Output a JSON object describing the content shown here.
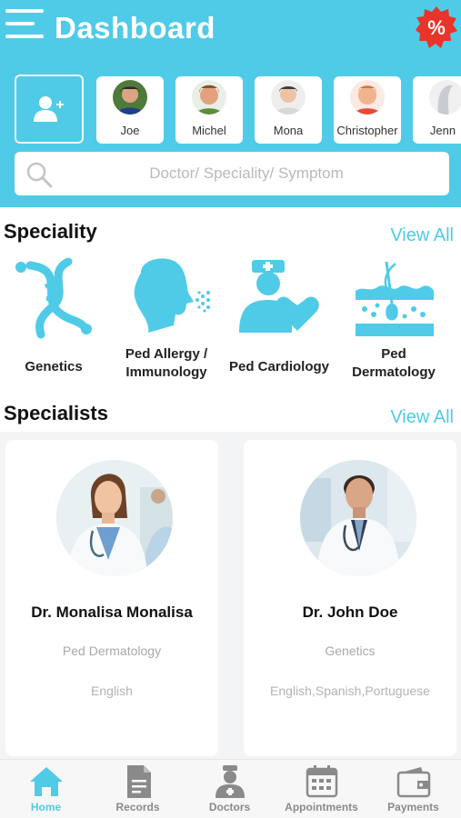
{
  "header": {
    "title": "Dashboard",
    "offer_symbol": "%"
  },
  "patients": [
    {
      "name": "Joe"
    },
    {
      "name": "Michel"
    },
    {
      "name": "Mona"
    },
    {
      "name": "Christopher"
    },
    {
      "name": "Jenn"
    }
  ],
  "search": {
    "placeholder": "Doctor/ Speciality/ Symptom"
  },
  "speciality": {
    "title": "Speciality",
    "view_all": "View All",
    "items": [
      {
        "line1": "Genetics",
        "line2": ""
      },
      {
        "line1": "Ped Allergy /",
        "line2": "Immunology"
      },
      {
        "line1": "Ped Cardiology",
        "line2": ""
      },
      {
        "line1": "Ped",
        "line2": "Dermatology"
      }
    ]
  },
  "specialists": {
    "title": "Specialists",
    "view_all": "View All",
    "doctors": [
      {
        "name": "Dr.  Monalisa Monalisa",
        "speciality": "Ped Dermatology",
        "languages": "English"
      },
      {
        "name": "Dr. John Doe",
        "speciality": "Genetics",
        "languages": "English,Spanish,Portuguese"
      }
    ]
  },
  "bottom_nav": [
    {
      "label": "Home",
      "icon": "home-icon",
      "active": true
    },
    {
      "label": "Records",
      "icon": "records-icon",
      "active": false
    },
    {
      "label": "Doctors",
      "icon": "doctor-icon",
      "active": false
    },
    {
      "label": "Appointments",
      "icon": "calendar-icon",
      "active": false
    },
    {
      "label": "Payments",
      "icon": "wallet-icon",
      "active": false
    }
  ],
  "colors": {
    "accent": "#4fcbe8",
    "badge": "#e8342a",
    "nav_inactive": "#8a8a8a"
  }
}
